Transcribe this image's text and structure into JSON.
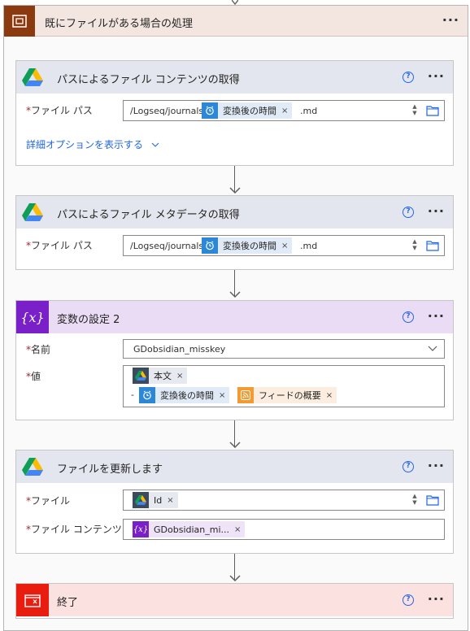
{
  "scope": {
    "title": "既にファイルがある場合の処理",
    "icon": "scope-icon",
    "more_label": "···"
  },
  "card1": {
    "title": "パスによるファイル コンテンツの取得",
    "help": "?",
    "more_label": "···",
    "field_label": "ファイル パス",
    "path_prefix": "/Logseq/journals/",
    "token_label": "変換後の時間",
    "path_suffix": ".md",
    "advanced_link": "詳細オプションを表示する"
  },
  "card2": {
    "title": "パスによるファイル メタデータの取得",
    "help": "?",
    "more_label": "···",
    "field_label": "ファイル パス",
    "path_prefix": "/Logseq/journals/",
    "token_label": "変換後の時間",
    "path_suffix": ".md"
  },
  "card3": {
    "title": "変数の設定 2",
    "help": "?",
    "more_label": "···",
    "name_label": "名前",
    "name_value": "GDobsidian_misskey",
    "value_label": "値",
    "token_body": "本文",
    "dash": "-",
    "token_time": "変換後の時間",
    "token_feed": "フィードの概要"
  },
  "card4": {
    "title": "ファイルを更新します",
    "help": "?",
    "more_label": "···",
    "file_label": "ファイル",
    "token_id": "Id",
    "content_label": "ファイル コンテンツ",
    "token_var": "GDobsidian_mi..."
  },
  "card5": {
    "title": "終了",
    "help": "?",
    "more_label": "···"
  },
  "required_mark": "*",
  "close_mark": "×",
  "colors": {
    "scope_header": "#f3e6e0",
    "scope_icon": "#8b3a0f",
    "google_drive_header": "#e3e6ee",
    "variable": "#7a20c9",
    "terminate": "#e81c0f",
    "link": "#2266e3"
  }
}
